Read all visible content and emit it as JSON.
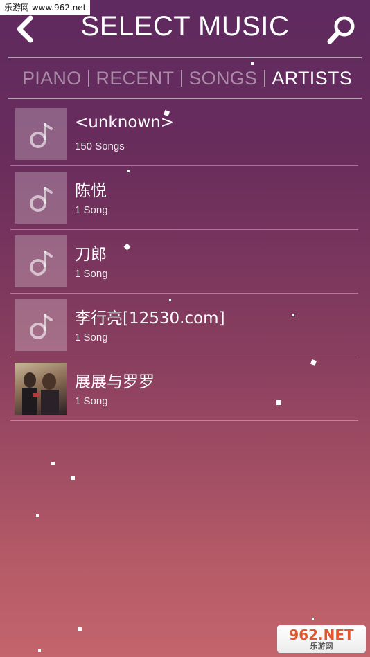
{
  "watermark": {
    "top_text": "乐游网 www.962.net",
    "bottom_main": "962.NET",
    "bottom_sub": "乐游网"
  },
  "header": {
    "title": "SELECT MUSIC",
    "back_icon": "chevron-left-icon",
    "search_icon": "search-icon"
  },
  "tabs": [
    {
      "label": "PIANO",
      "active": false
    },
    {
      "label": "RECENT",
      "active": false
    },
    {
      "label": "SONGS",
      "active": false
    },
    {
      "label": "ARTISTS",
      "active": true
    }
  ],
  "artists": [
    {
      "name": "<unknown>",
      "count": "150 Songs",
      "thumb": "music-note-icon"
    },
    {
      "name": "陈悦",
      "count": "1 Song",
      "thumb": "music-note-icon"
    },
    {
      "name": "刀郎",
      "count": "1 Song",
      "thumb": "music-note-icon"
    },
    {
      "name": "李行亮[12530.com]",
      "count": "1 Song",
      "thumb": "music-note-icon"
    },
    {
      "name": "展展与罗罗",
      "count": "1 Song",
      "thumb": "album-photo"
    }
  ],
  "colors": {
    "bg_top": "#5e2a5f",
    "bg_bottom": "#c4646c",
    "inactive_tab": "rgba(255,255,255,0.45)"
  }
}
